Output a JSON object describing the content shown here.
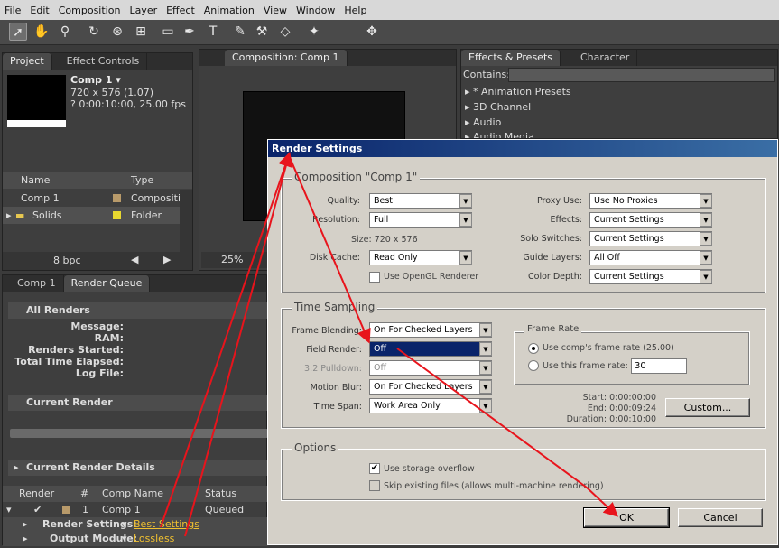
{
  "menu": [
    "File",
    "Edit",
    "Composition",
    "Layer",
    "Effect",
    "Animation",
    "View",
    "Window",
    "Help"
  ],
  "project": {
    "tabs": [
      "Project",
      "Effect Controls"
    ],
    "comp_name": "Comp 1 ▾",
    "comp_size": "720 x 576 (1.07)",
    "comp_duration": "? 0:00:10:00, 25.00 fps",
    "columns": [
      "Name",
      "Type"
    ],
    "items": [
      {
        "name": "Comp 1",
        "type": "Compositio",
        "color": "#b89a6a"
      },
      {
        "name": "Solids",
        "type": "Folder",
        "color": "#e8d830"
      }
    ],
    "bpc": "8 bpc"
  },
  "composition": {
    "tab": "Composition: Comp 1",
    "zoom": "25%"
  },
  "effects": {
    "tabs": [
      "Effects & Presets",
      "Character"
    ],
    "contains_label": "Contains:",
    "items": [
      "* Animation Presets",
      "3D Channel",
      "Audio",
      "Audio Media"
    ]
  },
  "render_queue": {
    "tabs": [
      "Comp 1",
      "Render Queue"
    ],
    "all_renders": "All Renders",
    "fields": [
      "Message:",
      "RAM:",
      "Renders Started:",
      "Total Time Elapsed:",
      "Log File:"
    ],
    "current_render": "Current Render",
    "current_render_details": "Current Render Details",
    "columns": [
      "Render",
      "#",
      "Comp Name",
      "Status"
    ],
    "row": {
      "num": "1",
      "comp": "Comp 1",
      "status": "Queued"
    },
    "render_settings_label": "Render Settings:",
    "render_settings_value": "Best Settings",
    "output_module_label": "Output Module:",
    "output_module_value": "Lossless"
  },
  "dialog": {
    "title": "Render Settings",
    "composition_group": "Composition \"Comp 1\"",
    "quality_label": "Quality:",
    "quality": "Best",
    "resolution_label": "Resolution:",
    "resolution": "Full",
    "size": "Size:  720 x 576",
    "disk_cache_label": "Disk Cache:",
    "disk_cache": "Read Only",
    "opengl": "Use OpenGL Renderer",
    "proxy_label": "Proxy Use:",
    "proxy": "Use No Proxies",
    "effects_label": "Effects:",
    "effects": "Current Settings",
    "solo_label": "Solo Switches:",
    "solo": "Current Settings",
    "guide_label": "Guide Layers:",
    "guide": "All Off",
    "depth_label": "Color Depth:",
    "depth": "Current Settings",
    "time_group": "Time Sampling",
    "frame_blending_label": "Frame Blending:",
    "frame_blending": "On For Checked Layers",
    "field_render_label": "Field Render:",
    "field_render": "Off",
    "pulldown_label": "3:2 Pulldown:",
    "pulldown": "Off",
    "motion_blur_label": "Motion Blur:",
    "motion_blur": "On For Checked Layers",
    "time_span_label": "Time Span:",
    "time_span": "Work Area Only",
    "frame_rate_group": "Frame Rate",
    "use_comp_rate": "Use comp's frame rate (25.00)",
    "use_this_rate": "Use this frame rate:",
    "rate_value": "30",
    "start": "Start: 0:00:00:00",
    "end": "End: 0:00:09:24",
    "duration": "Duration: 0:00:10:00",
    "custom_button": "Custom...",
    "options_group": "Options",
    "storage_overflow": "Use storage overflow",
    "skip_existing": "Skip existing files (allows multi-machine rendering)",
    "ok": "OK",
    "cancel": "Cancel"
  },
  "colors": {
    "accent_arrow": "#e8141c",
    "titlebar": "#0a246a"
  }
}
